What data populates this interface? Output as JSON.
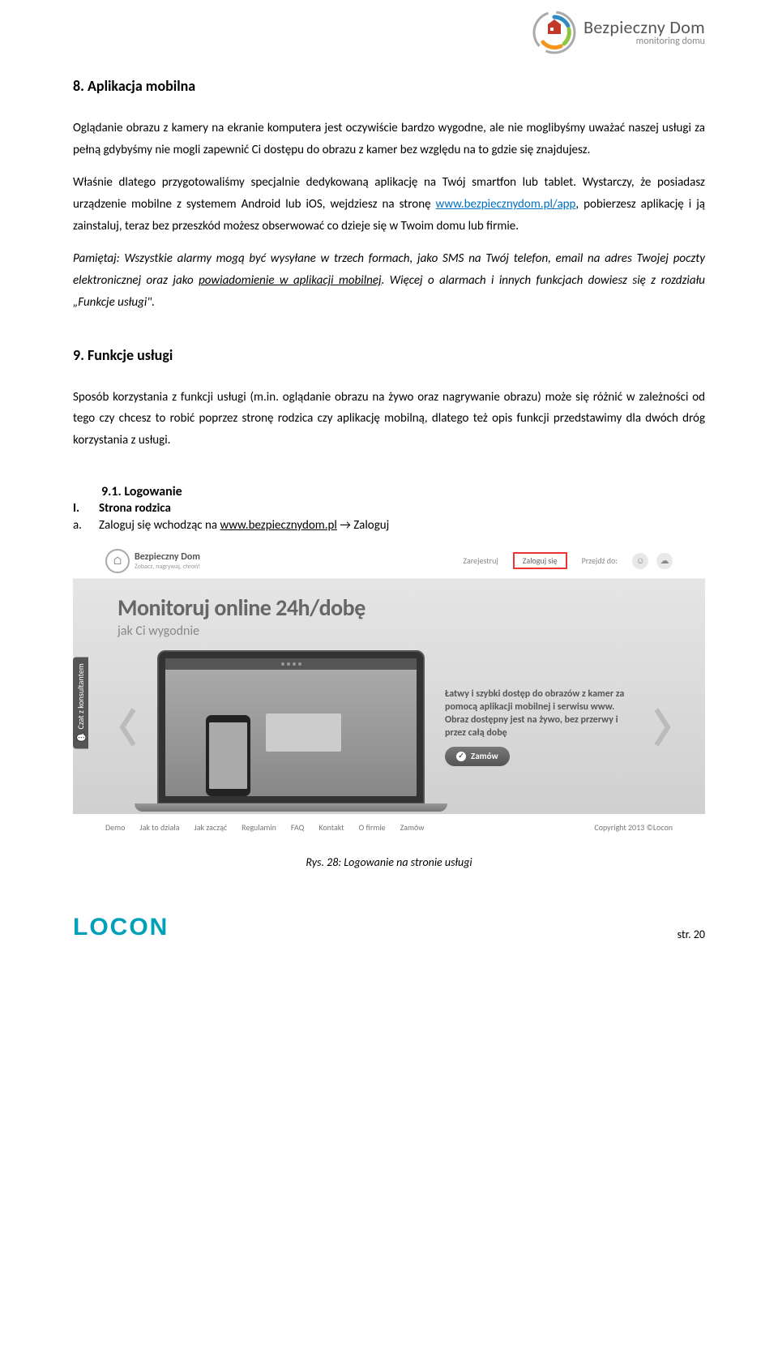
{
  "header_logo": {
    "title": "Bezpieczny Dom",
    "subtitle": "monitoring domu"
  },
  "section8": {
    "heading": "8.   Aplikacja mobilna",
    "para1_a": "Oglądanie obrazu z kamery na ekranie komputera jest oczywiście bardzo wygodne, ale nie moglibyśmy uważać naszej usługi za pełną gdybyśmy nie mogli zapewnić Ci dostępu do obrazu z kamer bez względu na to gdzie się znajdujesz.",
    "para1_b": "Właśnie dlatego przygotowaliśmy specjalnie dedykowaną aplikację na Twój smartfon lub tablet. Wystarczy, że posiadasz urządzenie mobilne z systemem Android lub iOS, wejdziesz na stronę ",
    "link1": "www.bezpiecznydom.pl/app",
    "para1_c": ", pobierzesz aplikację i ją zainstaluj, teraz bez przeszkód możesz obserwować co dzieje się w Twoim domu lub firmie.",
    "para2_a": "Pamiętaj: Wszystkie alarmy mogą być wysyłane w trzech formach, jako SMS na Twój telefon, email na adres Twojej poczty elektronicznej oraz jako ",
    "para2_under": "powiadomienie w aplikacji mobilnej",
    "para2_b": ". Więcej o alarmach i innych funkcjach dowiesz się z rozdziału „Funkcje usługi\"."
  },
  "section9": {
    "heading": "9.   Funkcje usługi",
    "para1": "Sposób korzystania z funkcji usługi (m.in. oglądanie obrazu na żywo oraz nagrywanie obrazu) może się różnić w zależności od tego czy chcesz to robić poprzez stronę rodzica czy aplikację mobilną, dlatego też opis funkcji przedstawimy dla dwóch dróg korzystania z usługi.",
    "sub91": "9.1.  Logowanie",
    "item_I_marker": "I.",
    "item_I": "Strona rodzica",
    "item_a_marker": "a.",
    "item_a_pre": "Zaloguj się wchodząc na ",
    "item_a_link": "www.bezpiecznydom.pl",
    "item_a_post": " → Zaloguj"
  },
  "screenshot": {
    "logo_title": "Bezpieczny Dom",
    "logo_sub": "Zobacz, nagrywaj, chroń!",
    "register": "Zarejestruj",
    "login": "Zaloguj się",
    "goto": "Przejdź do:",
    "hero_title": "Monitoruj online 24h/dobę",
    "hero_sub": "jak Ci wygodnie",
    "benefits": "Łatwy i szybki dostęp do obrazów z kamer za pomocą aplikacji mobilnej i serwisu www. Obraz dostępny jest na żywo, bez przerwy i przez całą dobę",
    "order": "Zamów",
    "chat": "Czat z konsultantem",
    "nav": [
      "Demo",
      "Jak to działa",
      "Jak zacząć",
      "Regulamin",
      "FAQ",
      "Kontakt",
      "O firmie",
      "Zamów"
    ],
    "copyright": "Copyright 2013 ©Locon"
  },
  "caption": "Rys. 28: Logowanie na stronie usługi",
  "footer_brand": "LOCON",
  "page_num": "str. 20"
}
